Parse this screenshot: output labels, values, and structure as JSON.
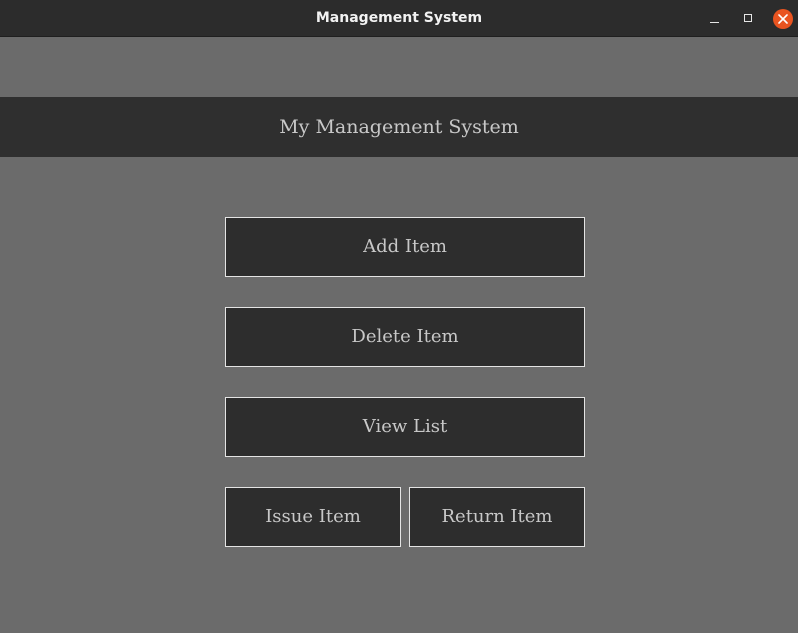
{
  "window": {
    "title": "Management System",
    "controls": {
      "minimize_icon": "minimize-icon",
      "maximize_icon": "maximize-icon",
      "close_icon": "close-icon"
    }
  },
  "header": {
    "title": "My Management System"
  },
  "buttons": {
    "add": "Add Item",
    "delete": "Delete Item",
    "view": "View List",
    "issue": "Issue Item",
    "return": "Return Item"
  },
  "colors": {
    "background": "#6b6b6b",
    "titlebar": "#2c2c2c",
    "header_band": "#2f2f2f",
    "button_bg": "#2d2d2d",
    "button_border": "#e4e4e4",
    "close_accent": "#e95420"
  }
}
